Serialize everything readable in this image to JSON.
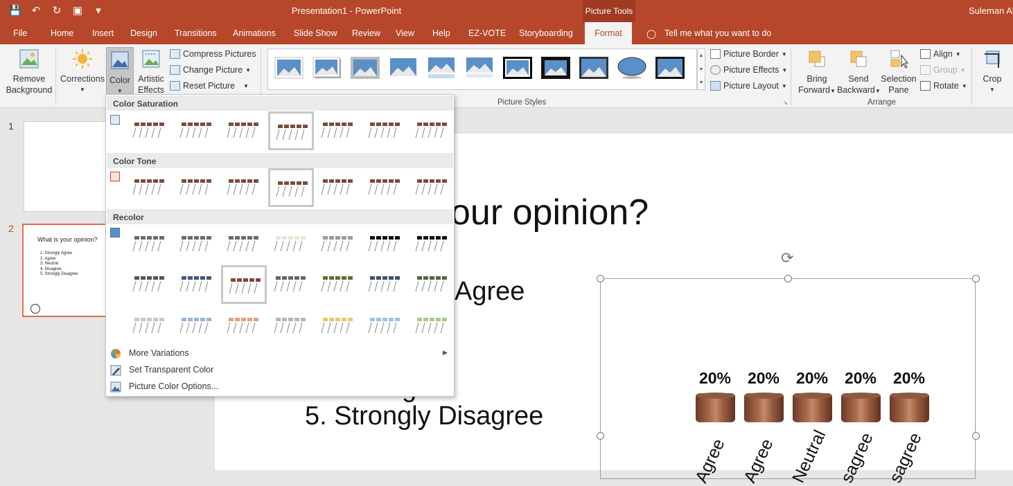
{
  "window": {
    "title": "Presentation1  -  PowerPoint",
    "context_tab": "Picture Tools",
    "user": "Suleman Ah"
  },
  "tabs": [
    "File",
    "Home",
    "Insert",
    "Design",
    "Transitions",
    "Animations",
    "Slide Show",
    "Review",
    "View",
    "Help",
    "EZ-VOTE",
    "Storyboarding",
    "Format"
  ],
  "active_tab": "Format",
  "tell_me": "Tell me what you want to do",
  "ribbon": {
    "remove_bg": [
      "Remove",
      "Background"
    ],
    "corrections": "Corrections",
    "color": "Color",
    "artistic": [
      "Artistic",
      "Effects"
    ],
    "compress": "Compress Pictures",
    "change": "Change Picture",
    "reset": "Reset Picture",
    "picture_styles": "Picture Styles",
    "border": "Picture Border",
    "effects": "Picture Effects",
    "layout": "Picture Layout",
    "bring": [
      "Bring",
      "Forward"
    ],
    "send": [
      "Send",
      "Backward"
    ],
    "selection": [
      "Selection",
      "Pane"
    ],
    "align": "Align",
    "group": "Group",
    "rotate": "Rotate",
    "arrange": "Arrange",
    "crop": "Crop"
  },
  "dropdown": {
    "saturation": "Color Saturation",
    "tone": "Color Tone",
    "recolor": "Recolor",
    "more": "More Variations",
    "transparent": "Set Transparent Color",
    "options": "Picture Color Options..."
  },
  "slides": {
    "n1": "1",
    "n2": "2",
    "thumb_title": "What is your opinion?",
    "thumb_items": [
      "1.  Strongly Agree",
      "2.  Agree",
      "3.  Neutral",
      "4.  Disagree",
      "5.  Strongly Disagree"
    ]
  },
  "slide": {
    "title_fragment": "our opinion?",
    "item_fragment": "Agree",
    "item5": "5.  Strongly Disagree",
    "item4_fragment": "g"
  },
  "chart_data": {
    "type": "bar",
    "categories": [
      "Agree",
      "Agree",
      "Neutral",
      "sagree",
      "sagree"
    ],
    "values": [
      20,
      20,
      20,
      20,
      20
    ],
    "labels": [
      "20%",
      "20%",
      "20%",
      "20%",
      "20%"
    ]
  }
}
